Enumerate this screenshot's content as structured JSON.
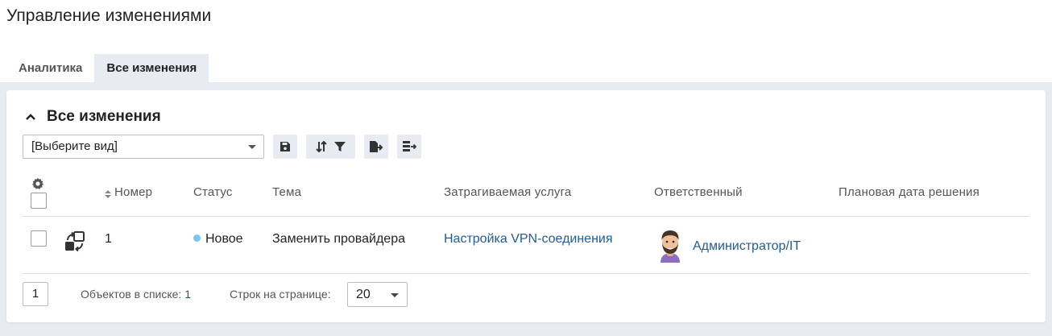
{
  "page": {
    "title": "Управление изменениями"
  },
  "tabs": [
    {
      "label": "Аналитика",
      "active": false
    },
    {
      "label": "Все изменения",
      "active": true
    }
  ],
  "section": {
    "title": "Все изменения"
  },
  "toolbar": {
    "view_select_value": "[Выберите вид]",
    "icons": [
      "save-icon",
      "sort-icon",
      "filter-icon",
      "export-icon",
      "export-list-icon"
    ]
  },
  "table": {
    "columns": [
      "Номер",
      "Статус",
      "Тема",
      "Затрагиваемая услуга",
      "Ответственный",
      "Плановая дата решения"
    ],
    "rows": [
      {
        "number": "1",
        "status": "Новое",
        "subject": "Заменить провайдера",
        "service": "Настройка VPN-соединения",
        "responsible": "Администратор/IT",
        "planned_date": ""
      }
    ]
  },
  "footer": {
    "page": "1",
    "objects_label": "Объектов в списке:",
    "objects_count": "1",
    "rows_label": "Строк на странице:",
    "rows_value": "20"
  },
  "colors": {
    "accent_link": "#1f5c99",
    "status_new": "#7ec3f2",
    "panel_bg": "#e8ecf2"
  }
}
